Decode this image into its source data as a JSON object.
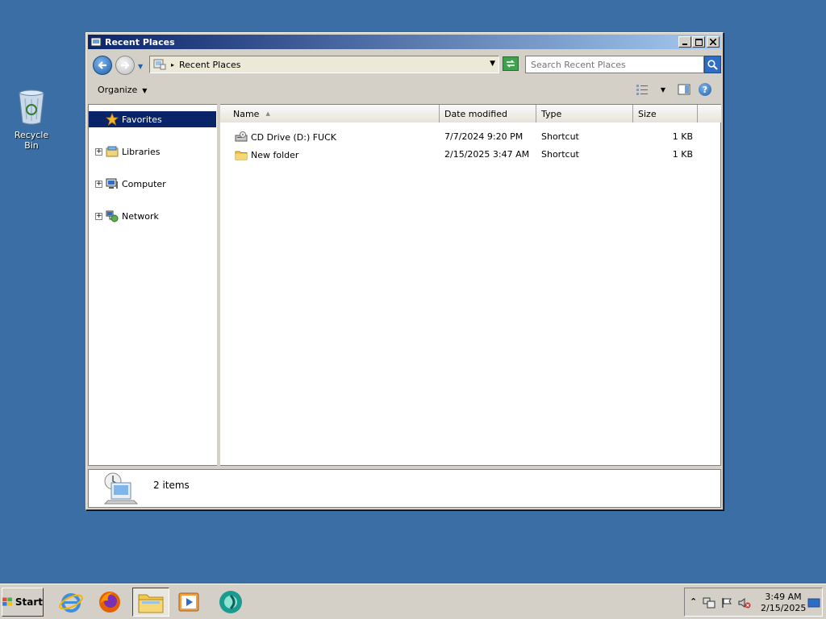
{
  "desktop": {
    "recycle_bin_label": "Recycle Bin"
  },
  "window": {
    "title": "Recent Places",
    "address": {
      "crumb": "Recent Places"
    },
    "search": {
      "placeholder": "Search Recent Places"
    },
    "toolbar": {
      "organize_label": "Organize"
    },
    "nav": {
      "items": [
        {
          "label": "Favorites",
          "icon": "star-icon",
          "selected": true
        },
        {
          "label": "Libraries",
          "icon": "libraries-icon"
        },
        {
          "label": "Computer",
          "icon": "computer-icon"
        },
        {
          "label": "Network",
          "icon": "network-icon"
        }
      ]
    },
    "columns": {
      "name": "Name",
      "date": "Date modified",
      "type": "Type",
      "size": "Size"
    },
    "files": [
      {
        "name": "CD Drive (D:) FUCK",
        "date": "7/7/2024 9:20 PM",
        "type": "Shortcut",
        "size": "1 KB",
        "icon": "cd-drive-icon"
      },
      {
        "name": "New folder",
        "date": "2/15/2025 3:47 AM",
        "type": "Shortcut",
        "size": "1 KB",
        "icon": "folder-icon"
      }
    ],
    "details": {
      "count": "2 items"
    }
  },
  "taskbar": {
    "start_label": "Start",
    "clock_time": "3:49 AM",
    "clock_date": "2/15/2025"
  },
  "colors": {
    "desktop": "#3a6ea5",
    "title_start": "#0a246a",
    "title_end": "#a6caf0",
    "selection": "#0a246a"
  }
}
